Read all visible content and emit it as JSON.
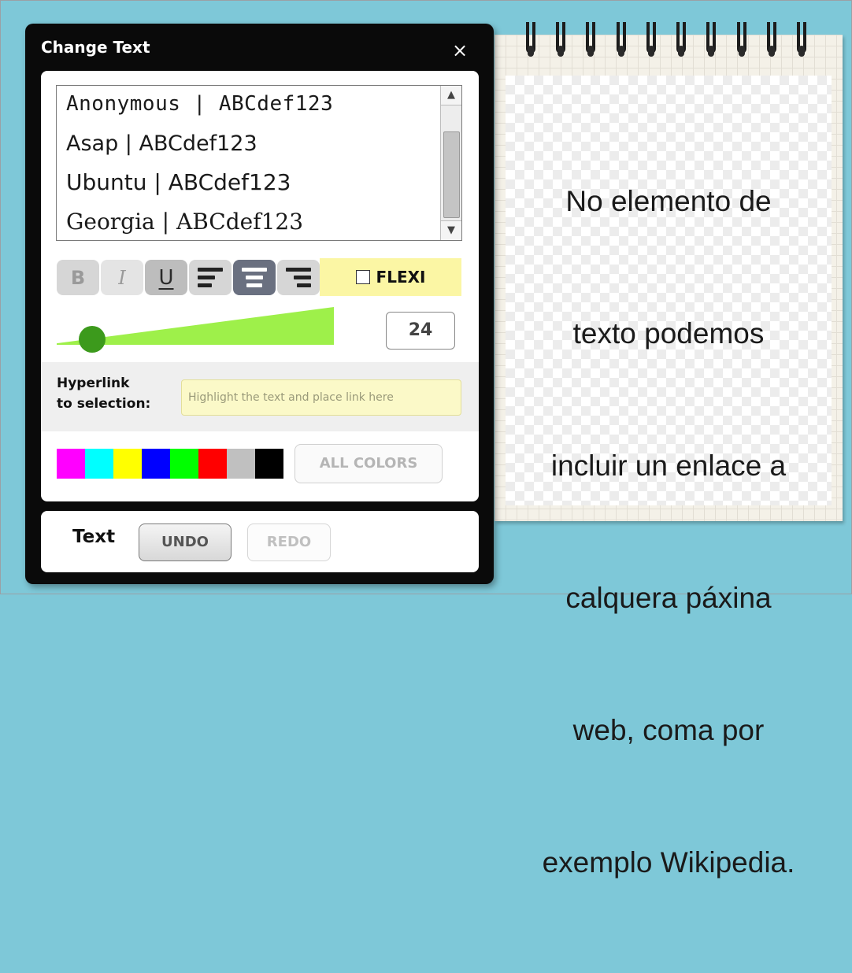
{
  "dialog": {
    "title": "Change Text",
    "close_glyph": "×"
  },
  "font_list": {
    "items": [
      {
        "name": "Anonymous",
        "label": "Anonymous  |  ABCdef123"
      },
      {
        "name": "Asap",
        "label": "Asap | ABCdef123"
      },
      {
        "name": "Ubuntu",
        "label": "Ubuntu | ABCdef123"
      },
      {
        "name": "Georgia",
        "label": "Georgia | ABCdef123"
      }
    ],
    "scroll_up_glyph": "▲",
    "scroll_down_glyph": "▼"
  },
  "toolbar": {
    "bold_label": "B",
    "italic_label": "I",
    "underline_label": "U",
    "active_alignment": "center",
    "flexi_label": "FLEXI",
    "flexi_checked": false
  },
  "size": {
    "value": "24"
  },
  "hyperlink": {
    "label_line1": "Hyperlink",
    "label_line2": "to selection:",
    "placeholder": "Highlight the text and place link here"
  },
  "colors": {
    "swatches": [
      "#ff00ff",
      "#00ffff",
      "#ffff00",
      "#0000ff",
      "#00ff00",
      "#ff0000",
      "#c0c0c0",
      "#000000"
    ],
    "all_colors_label": "ALL COLORS"
  },
  "bottom": {
    "label": "Text",
    "undo_label": "UNDO",
    "redo_label": "REDO"
  },
  "notepad": {
    "lines": [
      "No elemento de",
      "texto podemos",
      "incluir un enlace a",
      "calquera páxina",
      "web, coma por",
      "exemplo Wikipedia."
    ]
  },
  "theme": {
    "background": "#7ec8d8",
    "slider_color": "#9ef04a",
    "slider_thumb": "#3c9a1c",
    "flexi_bg": "#fbf6a4"
  }
}
